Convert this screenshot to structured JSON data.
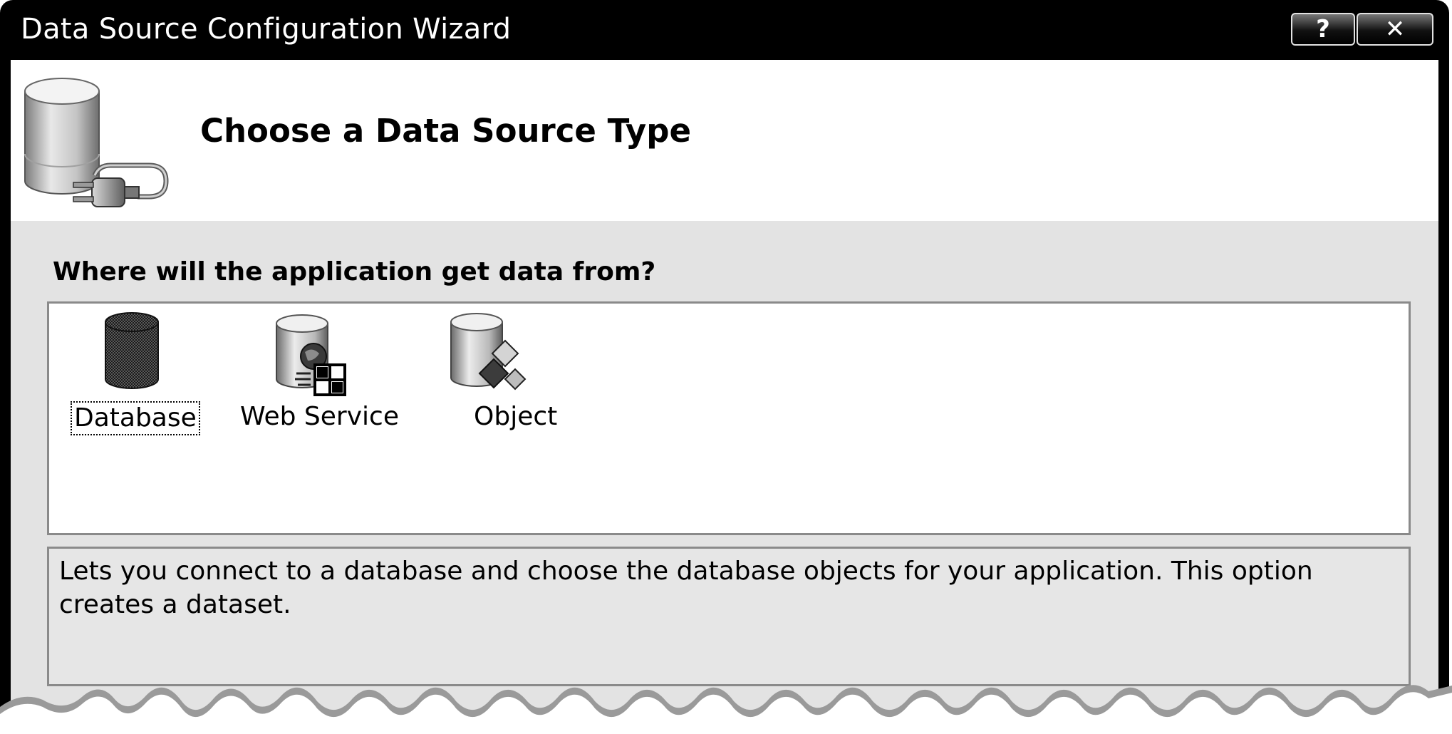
{
  "window": {
    "title": "Data Source Configuration Wizard",
    "help_glyph": "?",
    "close_glyph": "✕"
  },
  "header": {
    "title": "Choose a Data Source Type",
    "icon": "database-plug-icon"
  },
  "prompt": "Where will the application get data from?",
  "data_sources": {
    "selected": "Database",
    "items": [
      {
        "label": "Database",
        "icon": "database-icon"
      },
      {
        "label": "Web Service",
        "icon": "web-service-icon"
      },
      {
        "label": "Object",
        "icon": "object-icon"
      }
    ]
  },
  "description": "Lets you connect to a database and choose the database objects for your application. This option creates a dataset."
}
